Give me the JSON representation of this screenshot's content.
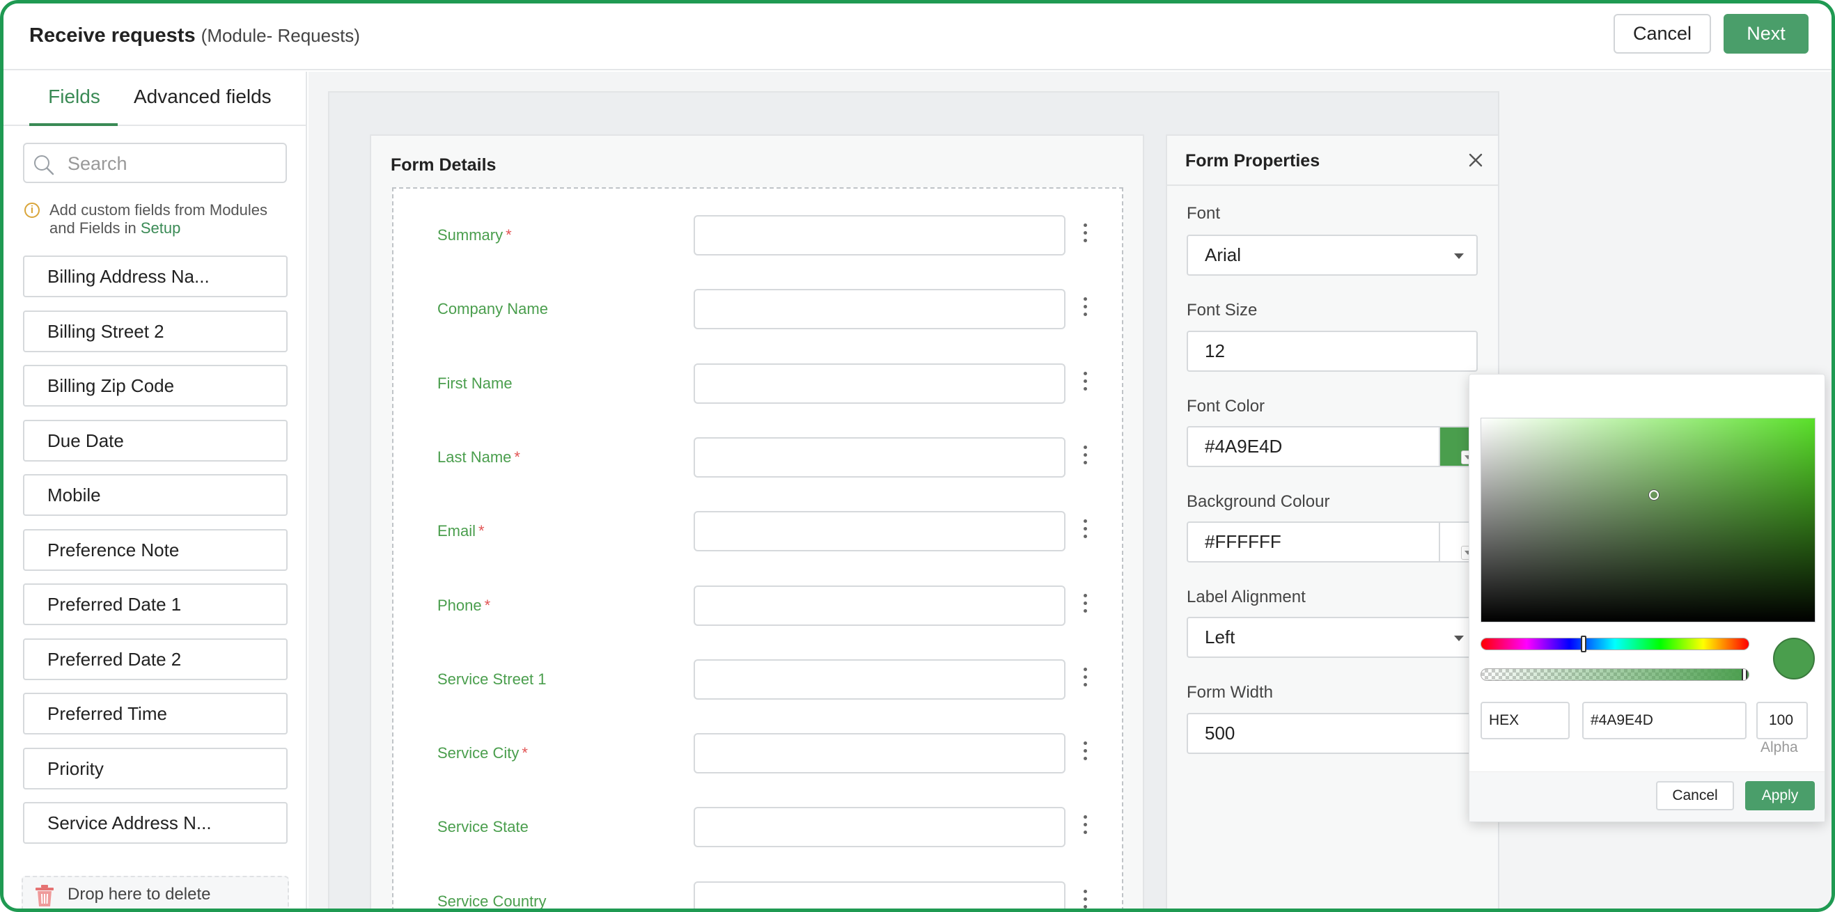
{
  "header": {
    "title": "Receive requests",
    "subtitle": "(Module- Requests)",
    "cancel_label": "Cancel",
    "next_label": "Next"
  },
  "left_panel": {
    "tabs": [
      {
        "label": "Fields",
        "active": true
      },
      {
        "label": "Advanced fields",
        "active": false
      }
    ],
    "search": {
      "placeholder": "Search",
      "value": ""
    },
    "info": {
      "icon": "info-icon",
      "text": "Add custom fields from Modules and Fields in",
      "link": "Setup"
    },
    "fields": [
      "Billing Address Na...",
      "Billing Street 2",
      "Billing Zip Code",
      "Due Date",
      "Mobile",
      "Preference Note",
      "Preferred Date 1",
      "Preferred Date 2",
      "Preferred Time",
      "Priority",
      "Service Address N..."
    ],
    "dropzone": {
      "icon": "trash-icon",
      "label": "Drop here to delete"
    }
  },
  "form": {
    "title": "Form Details",
    "rows": [
      {
        "label": "Summary",
        "required": true
      },
      {
        "label": "Company Name",
        "required": false
      },
      {
        "label": "First Name",
        "required": false
      },
      {
        "label": "Last Name",
        "required": true
      },
      {
        "label": "Email",
        "required": true
      },
      {
        "label": "Phone",
        "required": true
      },
      {
        "label": "Service Street 1",
        "required": false
      },
      {
        "label": "Service City",
        "required": true
      },
      {
        "label": "Service State",
        "required": false
      },
      {
        "label": "Service Country",
        "required": false
      }
    ],
    "required_mark": "*"
  },
  "properties": {
    "title": "Form Properties",
    "font_label": "Font",
    "font_value": "Arial",
    "font_size_label": "Font Size",
    "font_size_value": "12",
    "font_color_label": "Font Color",
    "font_color_value": "#4A9E4D",
    "bg_color_label": "Background Colour",
    "bg_color_value": "#FFFFFF",
    "label_alignment_label": "Label Alignment",
    "label_alignment_value": "Left",
    "form_width_label": "Form Width",
    "form_width_value": "500"
  },
  "color_picker": {
    "hue_color": "#5ae02a",
    "hue_fraction": 0.385,
    "saturation_fraction": 0.52,
    "value_fraction": 0.62,
    "alpha_fraction": 1.0,
    "selected_color": "#4A9E4D",
    "mode": "HEX",
    "hex_value": "#4A9E4D",
    "alpha_value": "100",
    "alpha_label": "Alpha",
    "cancel_label": "Cancel",
    "apply_label": "Apply"
  },
  "colors": {
    "accent": "#4a9e6a",
    "label_green": "#4a9e4d",
    "required_red": "#e25555",
    "frame_green": "#1f9a52"
  }
}
